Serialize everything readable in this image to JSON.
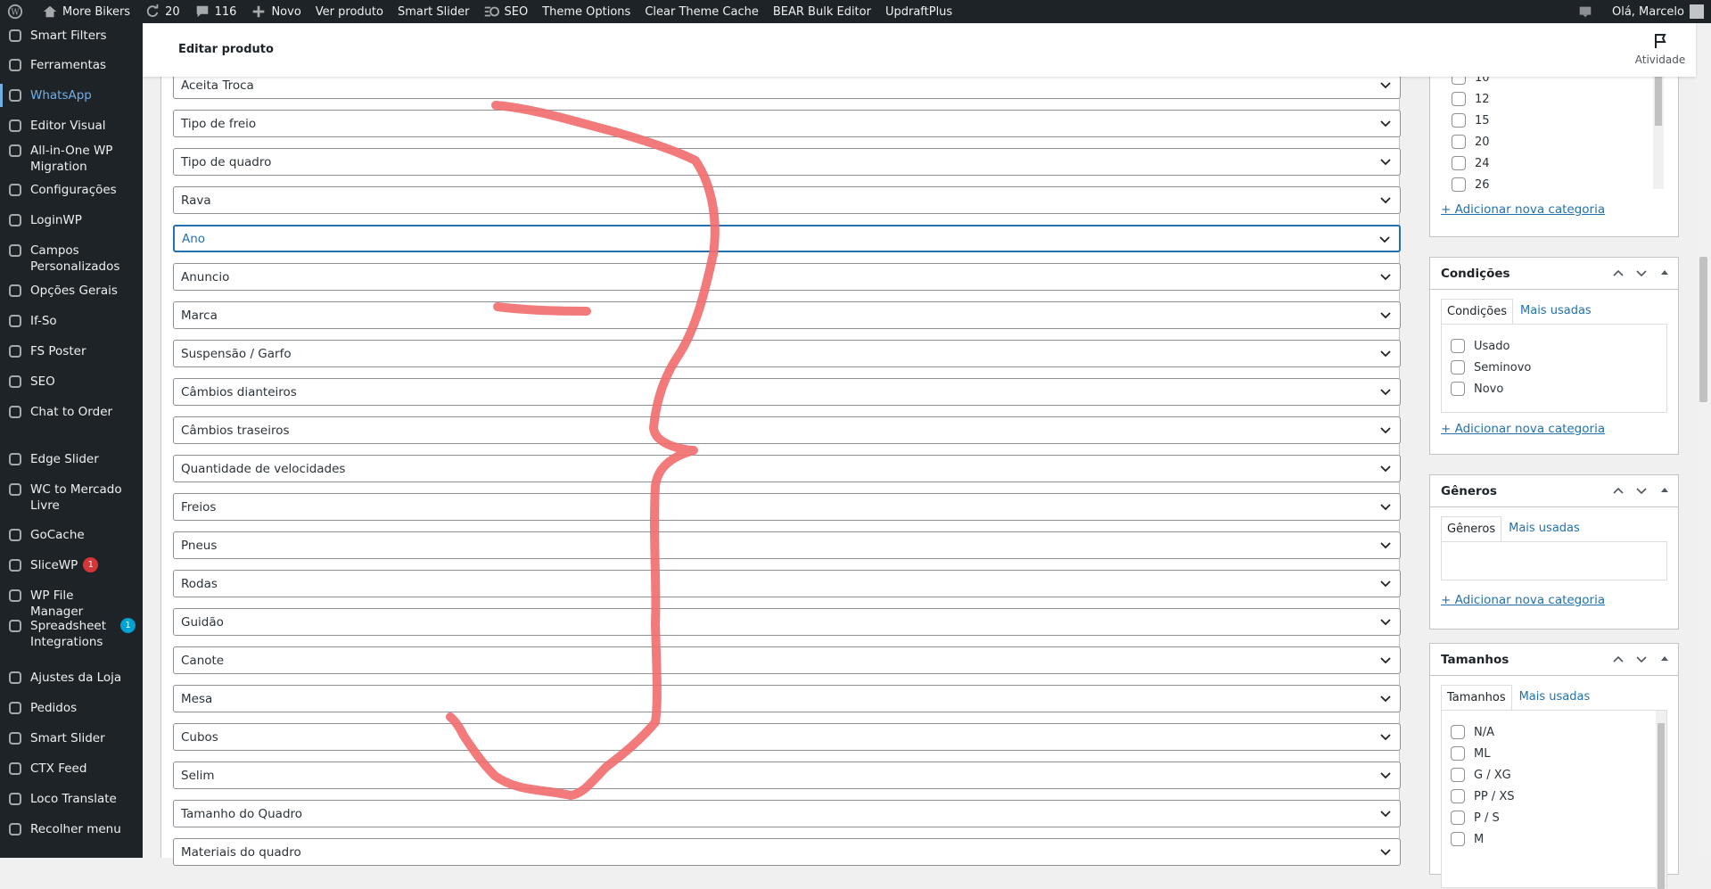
{
  "adminbar": {
    "site_name": "More Bikers",
    "updates_count": "20",
    "comments_count": "116",
    "new_label": "Novo",
    "view_product": "Ver produto",
    "smart_slider": "Smart Slider",
    "seo": "SEO",
    "theme_options": "Theme Options",
    "clear_cache": "Clear Theme Cache",
    "bear": "BEAR Bulk Editor",
    "updraft": "UpdraftPlus",
    "greeting": "Olá, Marcelo"
  },
  "sidebar": {
    "items": [
      {
        "label": "Smart Filters",
        "icon": "filter-icon"
      },
      {
        "label": "Ferramentas",
        "icon": "wrench-icon"
      },
      {
        "label": "WhatsApp",
        "icon": "quote-icon"
      },
      {
        "label": "Editor Visual",
        "icon": "palette-icon"
      },
      {
        "label": "All-in-One WP Migration",
        "icon": "migration-icon"
      },
      {
        "label": "Configurações",
        "icon": "settings-icon"
      },
      {
        "label": "LoginWP",
        "icon": "home-icon"
      },
      {
        "label": "Campos Personalizados",
        "icon": "grid-icon"
      },
      {
        "label": "Opções Gerais",
        "icon": "gear-icon"
      },
      {
        "label": "If-So",
        "icon": "dots-icon"
      },
      {
        "label": "FS Poster",
        "icon": "poster-icon"
      },
      {
        "label": "SEO",
        "icon": "seo-icon"
      },
      {
        "label": "Chat to Order",
        "icon": "whatsapp-icon"
      },
      {
        "label": "Edge Slider",
        "icon": "slider-icon"
      },
      {
        "label": "WC to Mercado Livre",
        "icon": "gear-icon"
      },
      {
        "label": "GoCache",
        "icon": "cloud-icon"
      },
      {
        "label": "SliceWP",
        "icon": "pie-icon",
        "badge": "1"
      },
      {
        "label": "WP File Manager",
        "icon": "folder-icon"
      },
      {
        "label": "Spreadsheet Integrations",
        "icon": "sheet-icon",
        "badge": "1"
      },
      {
        "label": "Ajustes da Loja",
        "icon": "gear-icon"
      },
      {
        "label": "Pedidos",
        "icon": "gear-icon"
      },
      {
        "label": "Smart Slider",
        "icon": "slider-icon"
      },
      {
        "label": "CTX Feed",
        "icon": "doc-icon"
      },
      {
        "label": "Loco Translate",
        "icon": "translate-icon"
      },
      {
        "label": "Recolher menu",
        "icon": "collapse-icon"
      }
    ]
  },
  "header": {
    "title": "Editar produto",
    "activity": "Atividade"
  },
  "attributes": [
    "Aceita Troca",
    "Tipo de freio",
    "Tipo de quadro",
    "Rava",
    "Ano",
    "Anuncio",
    "Marca",
    "Suspensão / Garfo",
    "Câmbios dianteiros",
    "Câmbios traseiros",
    "Quantidade de velocidades",
    "Freios",
    "Pneus",
    "Rodas",
    "Guidão",
    "Canote",
    "Mesa",
    "Cubos",
    "Selim",
    "Tamanho do Quadro",
    "Materiais do quadro"
  ],
  "categories_box": {
    "items": [
      "10",
      "12",
      "15",
      "20",
      "24",
      "26"
    ],
    "add_link": "+ Adicionar nova categoria"
  },
  "condicoes": {
    "title": "Condições",
    "tab_all": "Condições",
    "tab_popular": "Mais usadas",
    "items": [
      "Usado",
      "Seminovo",
      "Novo"
    ],
    "add_link": "+ Adicionar nova categoria"
  },
  "generos": {
    "title": "Gêneros",
    "tab_all": "Gêneros",
    "tab_popular": "Mais usadas",
    "add_link": "+ Adicionar nova categoria"
  },
  "tamanhos": {
    "title": "Tamanhos",
    "tab_all": "Tamanhos",
    "tab_popular": "Mais usadas",
    "items": [
      "N/A",
      "ML",
      "G / XG",
      "PP / XS",
      "P / S",
      "M"
    ]
  },
  "colors": {
    "admin_dark": "#1d2327",
    "link": "#2271b1",
    "active_menu": "#72aee6",
    "annotation": "#f26b6b"
  }
}
